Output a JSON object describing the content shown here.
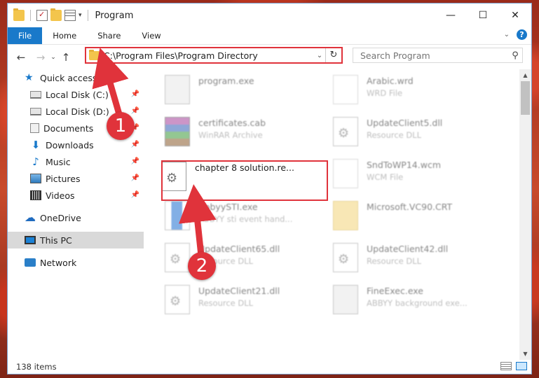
{
  "window": {
    "title": "Program"
  },
  "ribbon": {
    "tabs": [
      "File",
      "Home",
      "Share",
      "View"
    ]
  },
  "address": {
    "path": "C:\\Program Files\\Program Directory"
  },
  "search": {
    "placeholder": "Search Program"
  },
  "sidebar": {
    "items": [
      {
        "label": "Quick access",
        "icon": "star-icon"
      },
      {
        "label": "Local Disk (C:)",
        "icon": "disk-icon"
      },
      {
        "label": "Local Disk (D:)",
        "icon": "disk-icon"
      },
      {
        "label": "Documents",
        "icon": "documents-icon"
      },
      {
        "label": "Downloads",
        "icon": "downloads-icon"
      },
      {
        "label": "Music",
        "icon": "music-icon"
      },
      {
        "label": "Pictures",
        "icon": "pictures-icon"
      },
      {
        "label": "Videos",
        "icon": "videos-icon"
      },
      {
        "label": "OneDrive",
        "icon": "onedrive-icon"
      },
      {
        "label": "This PC",
        "icon": "this-pc-icon"
      },
      {
        "label": "Network",
        "icon": "network-icon"
      }
    ]
  },
  "files": [
    {
      "name": "program.exe",
      "type": ""
    },
    {
      "name": "Arabic.wrd",
      "type": "WRD File"
    },
    {
      "name": "certificates.cab",
      "type": "WinRAR Archive"
    },
    {
      "name": "UpdateClient5.dll",
      "type": "Resource DLL"
    },
    {
      "name": "chapter 8 solution.re...",
      "type": ""
    },
    {
      "name": "SndToWP14.wcm",
      "type": "WCM File"
    },
    {
      "name": "AbbyySTI.exe",
      "type": "ABBYY sti event hand..."
    },
    {
      "name": "Microsoft.VC90.CRT",
      "type": ""
    },
    {
      "name": "UpdateClient65.dll",
      "type": "Resource DLL"
    },
    {
      "name": "UpdateClient42.dll",
      "type": "Resource DLL"
    },
    {
      "name": "UpdateClient21.dll",
      "type": "Resource DLL"
    },
    {
      "name": "FineExec.exe",
      "type": "ABBYY background exe..."
    }
  ],
  "status": {
    "item_count": "138 items"
  },
  "callouts": {
    "one": "1",
    "two": "2"
  },
  "colors": {
    "accent": "#1979ca",
    "highlight": "#e0333b"
  }
}
